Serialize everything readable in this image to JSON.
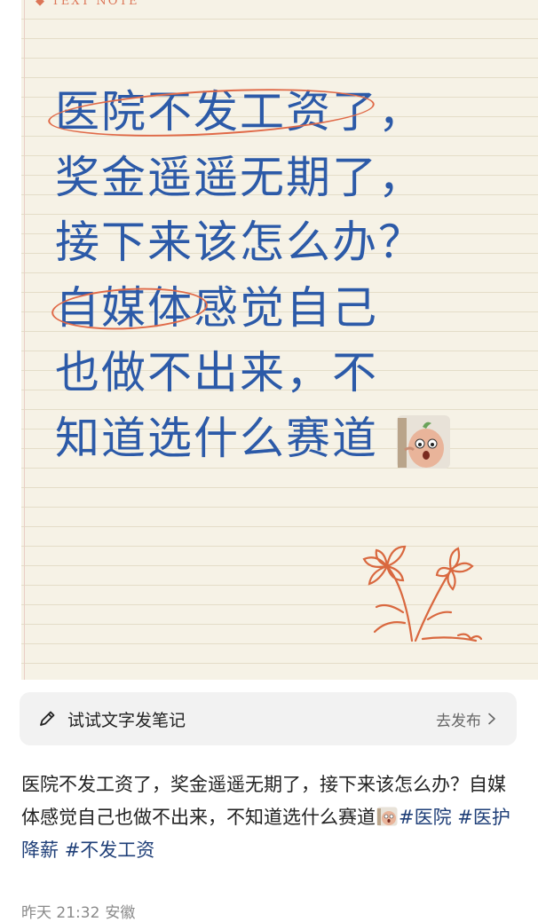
{
  "note": {
    "header": "◆ TEXT NOTE",
    "handwriting_lines": [
      "医院不发工资了，",
      "奖金遥遥无期了，",
      "接下来该怎么办？",
      "自媒体感觉自己",
      "也做不出来，不",
      "知道选什么赛道"
    ],
    "ink_color": "#2c5aa8",
    "mark_color": "#e06a48",
    "sticker_icon": "peeking-bean-emoji-icon",
    "decoration_icon": "flower-doodle-icon"
  },
  "prompt_bar": {
    "icon": "pencil-icon",
    "label": "试试文字发笔记",
    "action_label": "去发布",
    "action_icon": "chevron-right-icon"
  },
  "post": {
    "text": "医院不发工资了，奖金遥遥无期了，接下来该怎么办？自媒体感觉自己也做不出来，不知道选什么赛道",
    "inline_sticker": "peeking-bean-emoji-icon",
    "tags": [
      "#医院",
      "#医护降薪",
      "#不发工资"
    ],
    "tag_color": "#1f3f78"
  },
  "meta": {
    "time": "昨天 21:32",
    "location": "安徽"
  }
}
